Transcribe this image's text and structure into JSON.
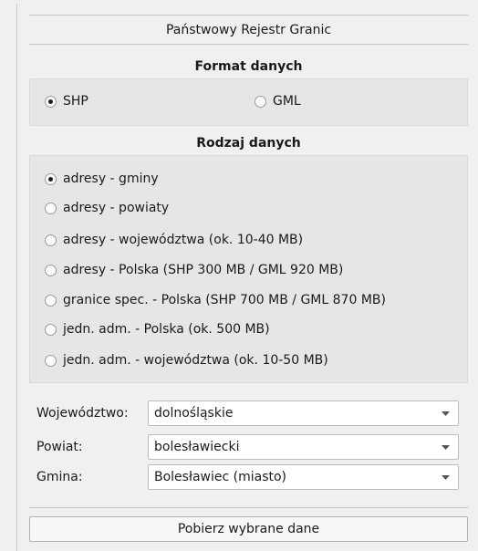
{
  "panel": {
    "title": "Państwowy Rejestr Granic"
  },
  "format": {
    "heading": "Format danych",
    "options": [
      {
        "label": "SHP",
        "checked": true
      },
      {
        "label": "GML",
        "checked": false
      }
    ]
  },
  "data_type": {
    "heading": "Rodzaj danych",
    "options": [
      {
        "label": "adresy - gminy",
        "checked": true
      },
      {
        "label": "adresy - powiaty",
        "checked": false
      },
      {
        "label": "adresy - województwa  (ok. 10-40 MB)",
        "checked": false
      },
      {
        "label": "adresy - Polska (SHP 300 MB / GML 920 MB)",
        "checked": false
      },
      {
        "label": "granice spec. - Polska (SHP 700 MB / GML 870 MB)",
        "checked": false
      },
      {
        "label": "jedn. adm. - Polska (ok. 500 MB)",
        "checked": false
      },
      {
        "label": "jedn. adm. - województwa (ok. 10-50 MB)",
        "checked": false
      }
    ]
  },
  "filters": {
    "voivodeship": {
      "label": "Województwo:",
      "value": "dolnośląskie"
    },
    "county": {
      "label": "Powiat:",
      "value": "bolesławiecki"
    },
    "commune": {
      "label": "Gmina:",
      "value": "Bolesławiec (miasto)"
    }
  },
  "actions": {
    "download_label": "Pobierz wybrane dane"
  }
}
